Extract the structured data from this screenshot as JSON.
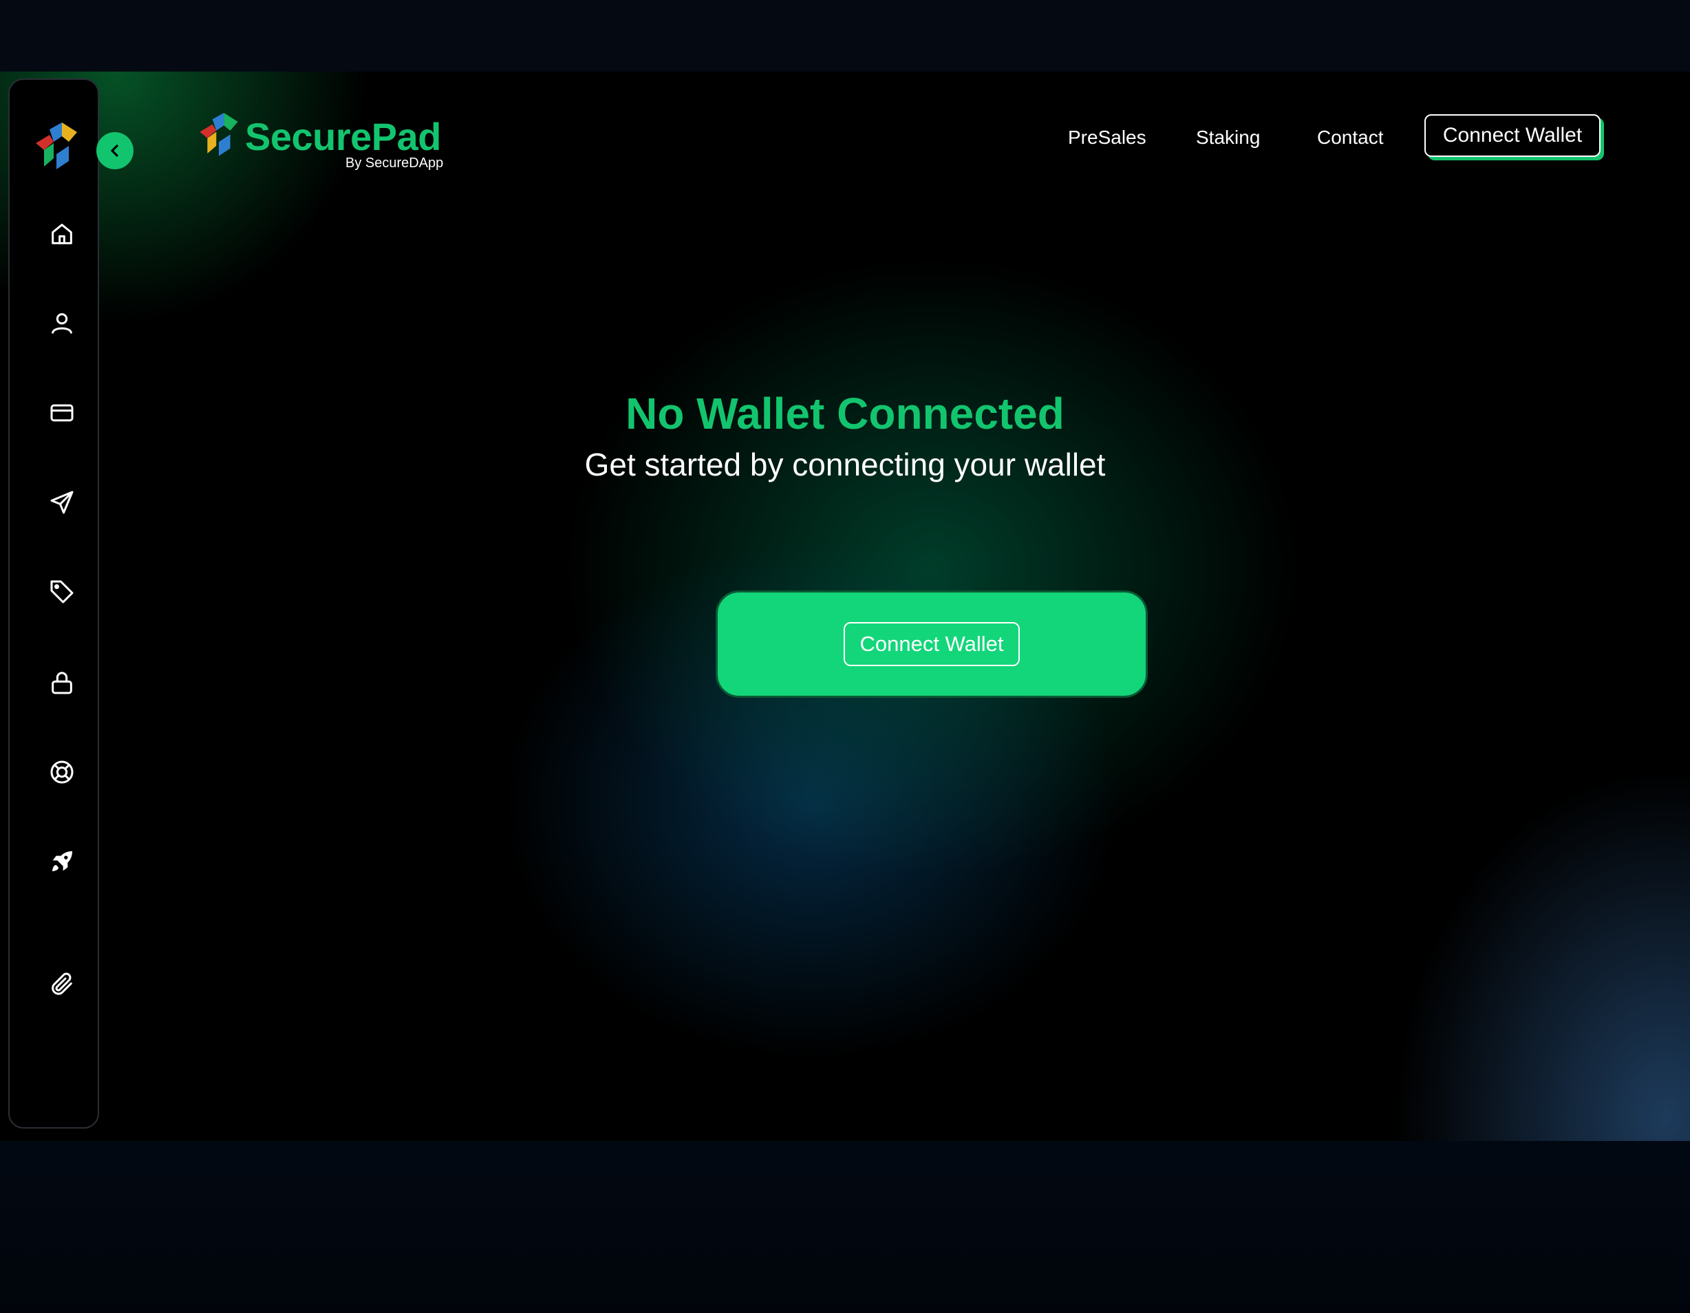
{
  "brand": {
    "name": "SecurePad",
    "tagline": "By SecureDApp",
    "accent_color": "#13c46e"
  },
  "header": {
    "nav": [
      "PreSales",
      "Staking",
      "Contact"
    ],
    "connect_label": "Connect Wallet"
  },
  "sidebar": {
    "collapse_icon": "chevron-left-icon",
    "items": [
      {
        "icon": "home-icon"
      },
      {
        "icon": "user-icon"
      },
      {
        "icon": "credit-card-icon"
      },
      {
        "icon": "send-icon"
      },
      {
        "icon": "tag-icon"
      },
      {
        "icon": "lock-icon"
      },
      {
        "icon": "lifebuoy-icon"
      },
      {
        "icon": "rocket-icon"
      },
      {
        "icon": "paperclip-icon"
      }
    ]
  },
  "main": {
    "title": "No Wallet Connected",
    "subtitle": "Get started by connecting your wallet",
    "cta_label": "Connect Wallet"
  }
}
